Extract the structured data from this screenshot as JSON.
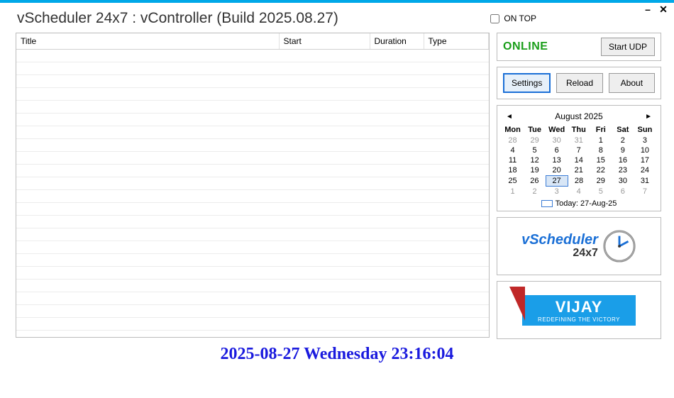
{
  "window": {
    "title": "vScheduler 24x7 : vController (Build 2025.08.27)",
    "on_top_label": "ON TOP",
    "on_top_checked": false
  },
  "table": {
    "headers": [
      "Title",
      "Start",
      "Duration",
      "Type"
    ],
    "rows": []
  },
  "status": {
    "text": "ONLINE",
    "udp_button": "Start UDP"
  },
  "buttons": {
    "settings": "Settings",
    "reload": "Reload",
    "about": "About"
  },
  "calendar": {
    "month_label": "August 2025",
    "day_headers": [
      "Mon",
      "Tue",
      "Wed",
      "Thu",
      "Fri",
      "Sat",
      "Sun"
    ],
    "weeks": [
      [
        {
          "d": "28",
          "o": true
        },
        {
          "d": "29",
          "o": true
        },
        {
          "d": "30",
          "o": true
        },
        {
          "d": "31",
          "o": true
        },
        {
          "d": "1"
        },
        {
          "d": "2"
        },
        {
          "d": "3"
        }
      ],
      [
        {
          "d": "4"
        },
        {
          "d": "5"
        },
        {
          "d": "6"
        },
        {
          "d": "7"
        },
        {
          "d": "8"
        },
        {
          "d": "9"
        },
        {
          "d": "10"
        }
      ],
      [
        {
          "d": "11"
        },
        {
          "d": "12"
        },
        {
          "d": "13"
        },
        {
          "d": "14"
        },
        {
          "d": "15"
        },
        {
          "d": "16"
        },
        {
          "d": "17"
        }
      ],
      [
        {
          "d": "18"
        },
        {
          "d": "19"
        },
        {
          "d": "20"
        },
        {
          "d": "21"
        },
        {
          "d": "22"
        },
        {
          "d": "23"
        },
        {
          "d": "24"
        }
      ],
      [
        {
          "d": "25"
        },
        {
          "d": "26"
        },
        {
          "d": "27",
          "sel": true
        },
        {
          "d": "28"
        },
        {
          "d": "29"
        },
        {
          "d": "30"
        },
        {
          "d": "31"
        }
      ],
      [
        {
          "d": "1",
          "o": true
        },
        {
          "d": "2",
          "o": true
        },
        {
          "d": "3",
          "o": true
        },
        {
          "d": "4",
          "o": true
        },
        {
          "d": "5",
          "o": true
        },
        {
          "d": "6",
          "o": true
        },
        {
          "d": "7",
          "o": true
        }
      ]
    ],
    "today_label": "Today: 27-Aug-25"
  },
  "logo": {
    "line1": "vScheduler",
    "line2": "24x7"
  },
  "vijay": {
    "title": "VIJAY",
    "subtitle": "REDEFINING THE VICTORY"
  },
  "footer": {
    "datetime": "2025-08-27  Wednesday  23:16:04"
  }
}
